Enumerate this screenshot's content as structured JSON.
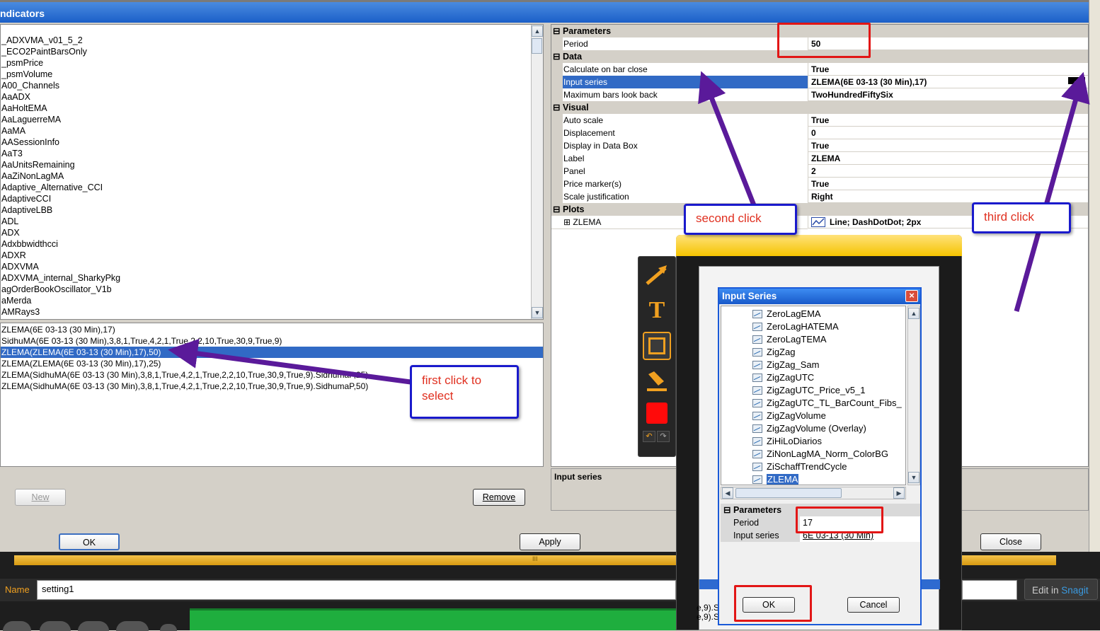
{
  "window": {
    "title": "ndicators"
  },
  "indicators_list": [
    "_ADXVMA_v01_5_2",
    "_ECO2PaintBarsOnly",
    "_psmPrice",
    "_psmVolume",
    "A00_Channels",
    "AaADX",
    "AaHoltEMA",
    "AaLaguerreMA",
    "AaMA",
    "AASessionInfo",
    "AaT3",
    "AaUnitsRemaining",
    "AaZiNonLagMA",
    "Adaptive_Alternative_CCI",
    "AdaptiveCCI",
    "AdaptiveLBB",
    "ADL",
    "ADX",
    "Adxbbwidthcci",
    "ADXR",
    "ADXVMA",
    "ADXVMA_internal_SharkyPkg",
    "agOrderBookOscillator_V1b",
    "aMerda",
    "AMRays3"
  ],
  "applied_list": [
    "ZLEMA(6E 03-13 (30 Min),17)",
    "SidhuMA(6E 03-13 (30 Min),3,8,1,True,4,2,1,True,2,2,10,True,30,9,True,9)",
    "ZLEMA(ZLEMA(6E 03-13 (30 Min),17),50)",
    "ZLEMA(ZLEMA(6E 03-13 (30 Min),17),25)",
    "ZLEMA(SidhuMA(6E 03-13 (30 Min),3,8,1,True,4,2,1,True,2,2,10,True,30,9,True,9).SidhumaP,25)",
    "ZLEMA(SidhuMA(6E 03-13 (30 Min),3,8,1,True,4,2,1,True,2,2,10,True,30,9,True,9).SidhumaP,50)"
  ],
  "properties": {
    "parameters": {
      "header": "Parameters",
      "period_name": "Period",
      "period_value": "50"
    },
    "data": {
      "header": "Data",
      "rows": [
        {
          "name": "Calculate on bar close",
          "value": "True"
        },
        {
          "name": "Input series",
          "value": "ZLEMA(6E 03-13 (30 Min),17)"
        },
        {
          "name": "Maximum bars look back",
          "value": "TwoHundredFiftySix"
        }
      ]
    },
    "visual": {
      "header": "Visual",
      "rows": [
        {
          "name": "Auto scale",
          "value": "True"
        },
        {
          "name": "Displacement",
          "value": "0"
        },
        {
          "name": "Display in Data Box",
          "value": "True"
        },
        {
          "name": "Label",
          "value": "ZLEMA"
        },
        {
          "name": "Panel",
          "value": "2"
        },
        {
          "name": "Price marker(s)",
          "value": "True"
        },
        {
          "name": "Scale justification",
          "value": "Right"
        }
      ]
    },
    "plots": {
      "header": "Plots",
      "name": "ZLEMA",
      "value": "Line; DashDotDot; 2px"
    }
  },
  "help_text": "Input series",
  "buttons": {
    "new": "New",
    "remove": "Remove",
    "ok": "OK",
    "apply": "Apply",
    "close": "Close",
    "ellipsis": "..."
  },
  "callouts": {
    "first_line1": "first click to",
    "first_line2": "select",
    "second": "second click",
    "third": "third click"
  },
  "input_series_dialog": {
    "title": "Input Series",
    "close": "×",
    "items": [
      "ZeroLagEMA",
      "ZeroLagHATEMA",
      "ZeroLagTEMA",
      "ZigZag",
      "ZigZag_Sam",
      "ZigZagUTC",
      "ZigZagUTC_Price_v5_1",
      "ZigZagUTC_TL_BarCount_Fibs_",
      "ZigZagVolume",
      "ZigZagVolume (Overlay)",
      "ZiHiLoDiarios",
      "ZiNonLagMA_Norm_ColorBG",
      "ZiSchaffTrendCycle",
      "ZLEMA"
    ],
    "params_header": "Parameters",
    "period_name": "Period",
    "period_value": "17",
    "input_name": "Input series",
    "input_value": "6E 03-13 (30 Min)",
    "ok": "OK",
    "cancel": "Cancel"
  },
  "snagit": {
    "name_label": "Name",
    "name_value": "setting1",
    "edit_in": "Edit in",
    "snagit": "Snagit",
    "scroll_mark": "III",
    "truncated": [
      "e,9).S",
      "e,9).S"
    ]
  }
}
